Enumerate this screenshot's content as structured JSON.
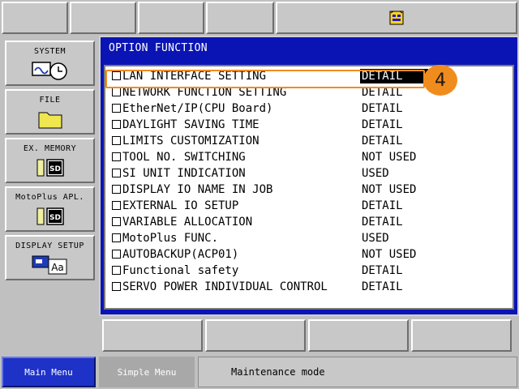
{
  "main": {
    "title": "OPTION FUNCTION",
    "options": [
      {
        "label": "LAN INTERFACE SETTING",
        "value": "DETAIL",
        "selected": true
      },
      {
        "label": "NETWORK FUNCTION SETTING",
        "value": "DETAIL"
      },
      {
        "label": "EtherNet/IP(CPU Board)",
        "value": "DETAIL"
      },
      {
        "label": "DAYLIGHT SAVING TIME",
        "value": "DETAIL"
      },
      {
        "label": "LIMITS CUSTOMIZATION",
        "value": "DETAIL"
      },
      {
        "label": "TOOL NO. SWITCHING",
        "value": "NOT USED"
      },
      {
        "label": "SI UNIT INDICATION",
        "value": "USED"
      },
      {
        "label": "DISPLAY IO NAME IN JOB",
        "value": "NOT USED"
      },
      {
        "label": "EXTERNAL IO SETUP",
        "value": "DETAIL"
      },
      {
        "label": "VARIABLE ALLOCATION",
        "value": "DETAIL"
      },
      {
        "label": "MotoPlus FUNC.",
        "value": "USED"
      },
      {
        "label": "AUTOBACKUP(ACP01)",
        "value": "NOT USED"
      },
      {
        "label": "Functional safety",
        "value": "DETAIL"
      },
      {
        "label": "SERVO POWER INDIVIDUAL CONTROL",
        "value": "DETAIL"
      }
    ]
  },
  "left_menu": {
    "items": [
      {
        "label": "SYSTEM",
        "icon": "clock-icon"
      },
      {
        "label": "FILE",
        "icon": "folder-icon"
      },
      {
        "label": "EX. MEMORY",
        "icon": "sd-card-icon"
      },
      {
        "label": "MotoPlus APL.",
        "icon": "sd-card-icon"
      },
      {
        "label": "DISPLAY SETUP",
        "icon": "display-font-icon"
      }
    ]
  },
  "annotation": {
    "step": "4",
    "color": "#f08c1e"
  },
  "bottom": {
    "main_menu": "Main Menu",
    "simple_menu": "Simple Menu",
    "status": "Maintenance mode"
  },
  "colors": {
    "window_bg": "#0a14b4",
    "accent": "#1e32c8"
  }
}
